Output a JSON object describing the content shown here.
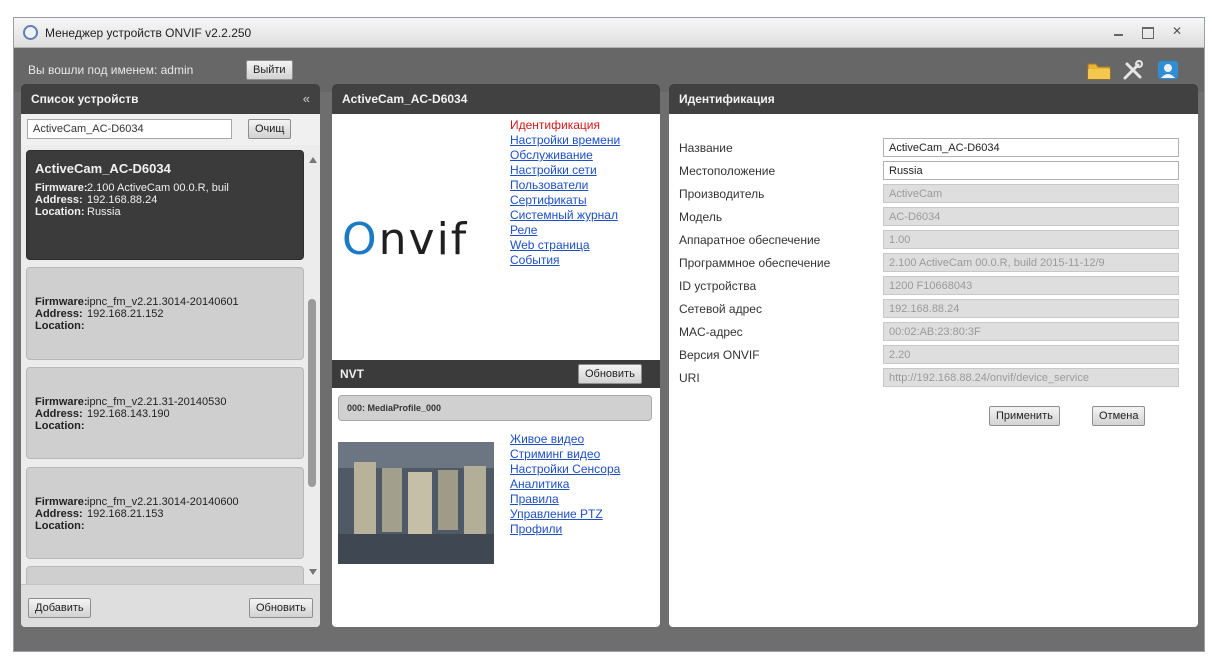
{
  "window": {
    "title": "Менеджер устройств ONVIF v2.2.250"
  },
  "toolbar": {
    "login_text": "Вы вошли под именем: admin",
    "logout_label": "Выйти",
    "icons": [
      "folder-icon",
      "tools-icon",
      "user-icon"
    ]
  },
  "device_list": {
    "title": "Список устройств",
    "collapse_glyph": "«",
    "search": {
      "value": "ActiveCam_AC-D6034",
      "clear_label": "Очищ"
    },
    "devices": [
      {
        "name": "ActiveCam_AC-D6034",
        "firmware": "2.100 ActiveCam 00.0.R, buil",
        "address": "192.168.88.24",
        "location": "Russia"
      },
      {
        "name": "",
        "firmware": "ipnc_fm_v2.21.3014-20140601",
        "address": "192.168.21.152",
        "location": ""
      },
      {
        "name": "",
        "firmware": "ipnc_fm_v2.21.31-20140530",
        "address": "192.168.143.190",
        "location": ""
      },
      {
        "name": "",
        "firmware": "ipnc_fm_v2.21.3014-20140600",
        "address": "192.168.21.153",
        "location": ""
      }
    ],
    "field_labels": {
      "firmware": "Firmware:",
      "address": "Address:",
      "location": "Location:"
    },
    "add_label": "Добавить",
    "refresh_label": "Обновить"
  },
  "device_panel": {
    "title": "ActiveCam_AC-D6034",
    "logo_text": "nvif",
    "logo_first": "O",
    "menu": [
      {
        "label": "Идентификация",
        "active": true
      },
      {
        "label": "Настройки времени",
        "active": false
      },
      {
        "label": "Обслуживание",
        "active": false
      },
      {
        "label": "Настройки сети",
        "active": false
      },
      {
        "label": "Пользователи",
        "active": false
      },
      {
        "label": "Сертификаты",
        "active": false
      },
      {
        "label": "Системный журнал",
        "active": false
      },
      {
        "label": "Реле",
        "active": false
      },
      {
        "label": "Web страница",
        "active": false
      },
      {
        "label": "События",
        "active": false
      }
    ],
    "nvt_label": "NVT",
    "nvt_refresh_label": "Обновить",
    "profile_label": "000: MediaProfile_000",
    "profile_menu": [
      "Живое видео",
      "Стриминг видео",
      "Настройки Сенсора",
      "Аналитика",
      "Правила",
      "Управление PTZ",
      "Профили"
    ]
  },
  "identification": {
    "title": "Идентификация",
    "fields": [
      {
        "label": "Название",
        "value": "ActiveCam_AC-D6034",
        "readonly": false
      },
      {
        "label": "Местоположение",
        "value": "Russia",
        "readonly": false
      },
      {
        "label": "Производитель",
        "value": "ActiveCam",
        "readonly": true
      },
      {
        "label": "Модель",
        "value": "AC-D6034",
        "readonly": true
      },
      {
        "label": "Аппаратное обеспечение",
        "value": "1.00",
        "readonly": true
      },
      {
        "label": "Программное обеспечение",
        "value": "2.100 ActiveCam 00.0.R, build 2015-11-12/9",
        "readonly": true
      },
      {
        "label": "ID устройства",
        "value": "1200 F10668043",
        "readonly": true
      },
      {
        "label": "Сетевой адрес",
        "value": "192.168.88.24",
        "readonly": true
      },
      {
        "label": "MAC-адрес",
        "value": "00:02:AB:23:80:3F",
        "readonly": true
      },
      {
        "label": "Версия ONVIF",
        "value": "2.20",
        "readonly": true
      },
      {
        "label": "URI",
        "value": "http://192.168.88.24/onvif/device_service",
        "readonly": true
      }
    ],
    "apply_label": "Применить",
    "cancel_label": "Отмена"
  }
}
